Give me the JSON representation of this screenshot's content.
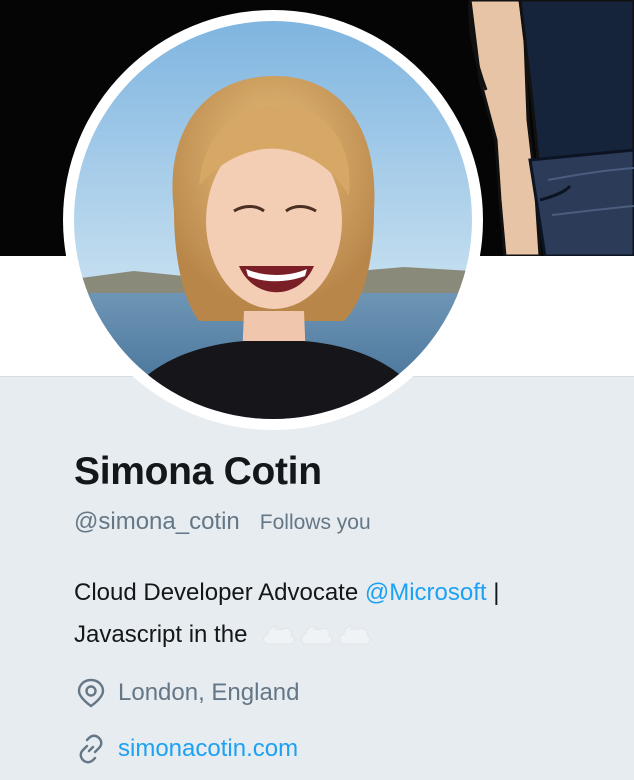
{
  "profile": {
    "name": "Simona Cotin",
    "handle": "@simona_cotin",
    "follows_badge": "Follows you",
    "bio": {
      "prefix": "Cloud Developer Advocate ",
      "mention": "@Microsoft",
      "suffix": " |",
      "line2": "Javascript in the"
    },
    "location": "London, England",
    "website": "simonacotin.com"
  },
  "icons": {
    "location": "map-pin-icon",
    "website": "link-icon",
    "bio_emoji": "cloud-icon"
  },
  "colors": {
    "accent": "#1da1f2",
    "secondary_text": "#657786",
    "primary_text": "#14171a",
    "page_bg": "#e6ecf0"
  }
}
